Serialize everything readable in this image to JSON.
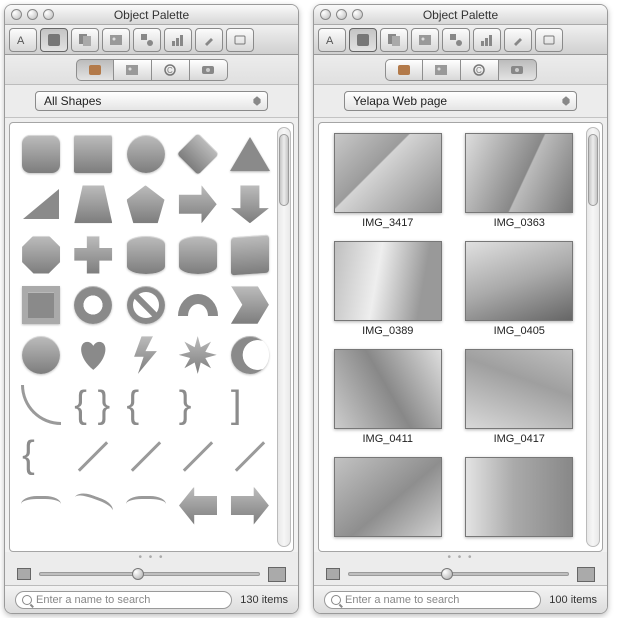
{
  "windows": [
    {
      "title": "Object Palette",
      "filter": "All Shapes",
      "search_placeholder": "Enter a name to search",
      "item_count": "130 items",
      "shapes": [
        "rounded-square",
        "square",
        "circle",
        "diamond",
        "triangle",
        "right-triangle",
        "trapezoid",
        "pentagon",
        "right-arrow",
        "down-arrow",
        "octagon",
        "plus",
        "cylinder",
        "cylinder-tall",
        "cube",
        "bevel-square",
        "donut",
        "no-sign",
        "arc",
        "chevron",
        "smiley",
        "heart",
        "lightning",
        "starburst",
        "crescent",
        "curve",
        "bracket-pair",
        "brace-open",
        "brace-close",
        "bracket-close",
        "brace-left",
        "line-diag",
        "line",
        "arrow-line",
        "arrow-line-2",
        "squiggle",
        "s-curve",
        "squiggle-arrow",
        "block-arrow-left",
        "block-arrow-right"
      ]
    },
    {
      "title": "Object Palette",
      "filter": "Yelapa Web page",
      "search_placeholder": "Enter a name to search",
      "item_count": "100 items",
      "photos": [
        "IMG_3417",
        "IMG_0363",
        "IMG_0389",
        "IMG_0405",
        "IMG_0411",
        "IMG_0417",
        "",
        ""
      ]
    }
  ]
}
